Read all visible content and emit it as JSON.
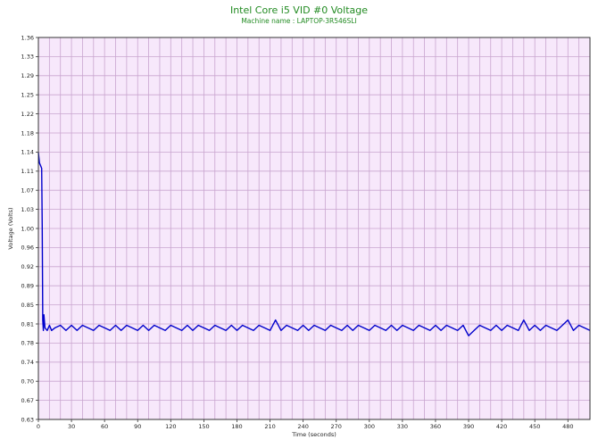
{
  "chart_data": {
    "type": "line",
    "title": "Intel Core i5 VID #0 Voltage",
    "subtitle": "Machine name : LAPTOP-3R546SLI",
    "xlabel": "Time (seconds)",
    "ylabel": "Voltage (Volts)",
    "xlim": [
      0,
      500
    ],
    "ylim": [
      0.63,
      1.36
    ],
    "x_ticks": [
      0,
      30,
      60,
      90,
      120,
      150,
      180,
      210,
      240,
      270,
      300,
      330,
      360,
      390,
      420,
      450,
      480
    ],
    "y_ticks": [
      "0.63",
      "0.67",
      "0.70",
      "0.74",
      "0.78",
      "0.81",
      "0.85",
      "0.89",
      "0.92",
      "0.96",
      "1.00",
      "1.03",
      "1.07",
      "1.11",
      "1.14",
      "1.18",
      "1.22",
      "1.25",
      "1.29",
      "1.33",
      "1.36"
    ],
    "grid": true,
    "series": [
      {
        "x": [
          0,
          1,
          2,
          3,
          3.5,
          4,
          4.5,
          5,
          6,
          8,
          10,
          12,
          15,
          20,
          25,
          30,
          35,
          40,
          45,
          50,
          55,
          60,
          65,
          70,
          75,
          80,
          85,
          90,
          95,
          100,
          105,
          110,
          115,
          120,
          125,
          130,
          135,
          140,
          145,
          150,
          155,
          160,
          165,
          170,
          175,
          180,
          185,
          190,
          195,
          200,
          205,
          210,
          215,
          220,
          225,
          230,
          235,
          240,
          245,
          250,
          255,
          260,
          265,
          270,
          275,
          280,
          285,
          290,
          295,
          300,
          305,
          310,
          315,
          320,
          325,
          330,
          335,
          340,
          345,
          350,
          355,
          360,
          365,
          370,
          375,
          380,
          385,
          390,
          395,
          400,
          405,
          410,
          415,
          420,
          425,
          430,
          435,
          440,
          445,
          450,
          455,
          460,
          465,
          470,
          475,
          480,
          485,
          490,
          495,
          500
        ],
        "values": [
          1.14,
          1.12,
          1.115,
          1.11,
          1.0,
          0.82,
          0.8,
          0.83,
          0.805,
          0.8,
          0.81,
          0.8,
          0.805,
          0.81,
          0.8,
          0.81,
          0.8,
          0.81,
          0.805,
          0.8,
          0.81,
          0.805,
          0.8,
          0.81,
          0.8,
          0.81,
          0.805,
          0.8,
          0.81,
          0.8,
          0.81,
          0.805,
          0.8,
          0.81,
          0.805,
          0.8,
          0.81,
          0.8,
          0.81,
          0.805,
          0.8,
          0.81,
          0.805,
          0.8,
          0.81,
          0.8,
          0.81,
          0.805,
          0.8,
          0.81,
          0.805,
          0.8,
          0.82,
          0.8,
          0.81,
          0.805,
          0.8,
          0.81,
          0.8,
          0.81,
          0.805,
          0.8,
          0.81,
          0.805,
          0.8,
          0.81,
          0.8,
          0.81,
          0.805,
          0.8,
          0.81,
          0.805,
          0.8,
          0.81,
          0.8,
          0.81,
          0.805,
          0.8,
          0.81,
          0.805,
          0.8,
          0.81,
          0.8,
          0.81,
          0.805,
          0.8,
          0.81,
          0.79,
          0.8,
          0.81,
          0.805,
          0.8,
          0.81,
          0.8,
          0.81,
          0.805,
          0.8,
          0.82,
          0.8,
          0.81,
          0.8,
          0.81,
          0.805,
          0.8,
          0.81,
          0.82,
          0.8,
          0.81,
          0.805,
          0.8
        ]
      }
    ],
    "colors": {
      "line": "#0000cc",
      "plot_bg": "#f7e8fb",
      "grid": "#c9a5cf",
      "title": "#228b22",
      "axis": "#333333"
    }
  }
}
